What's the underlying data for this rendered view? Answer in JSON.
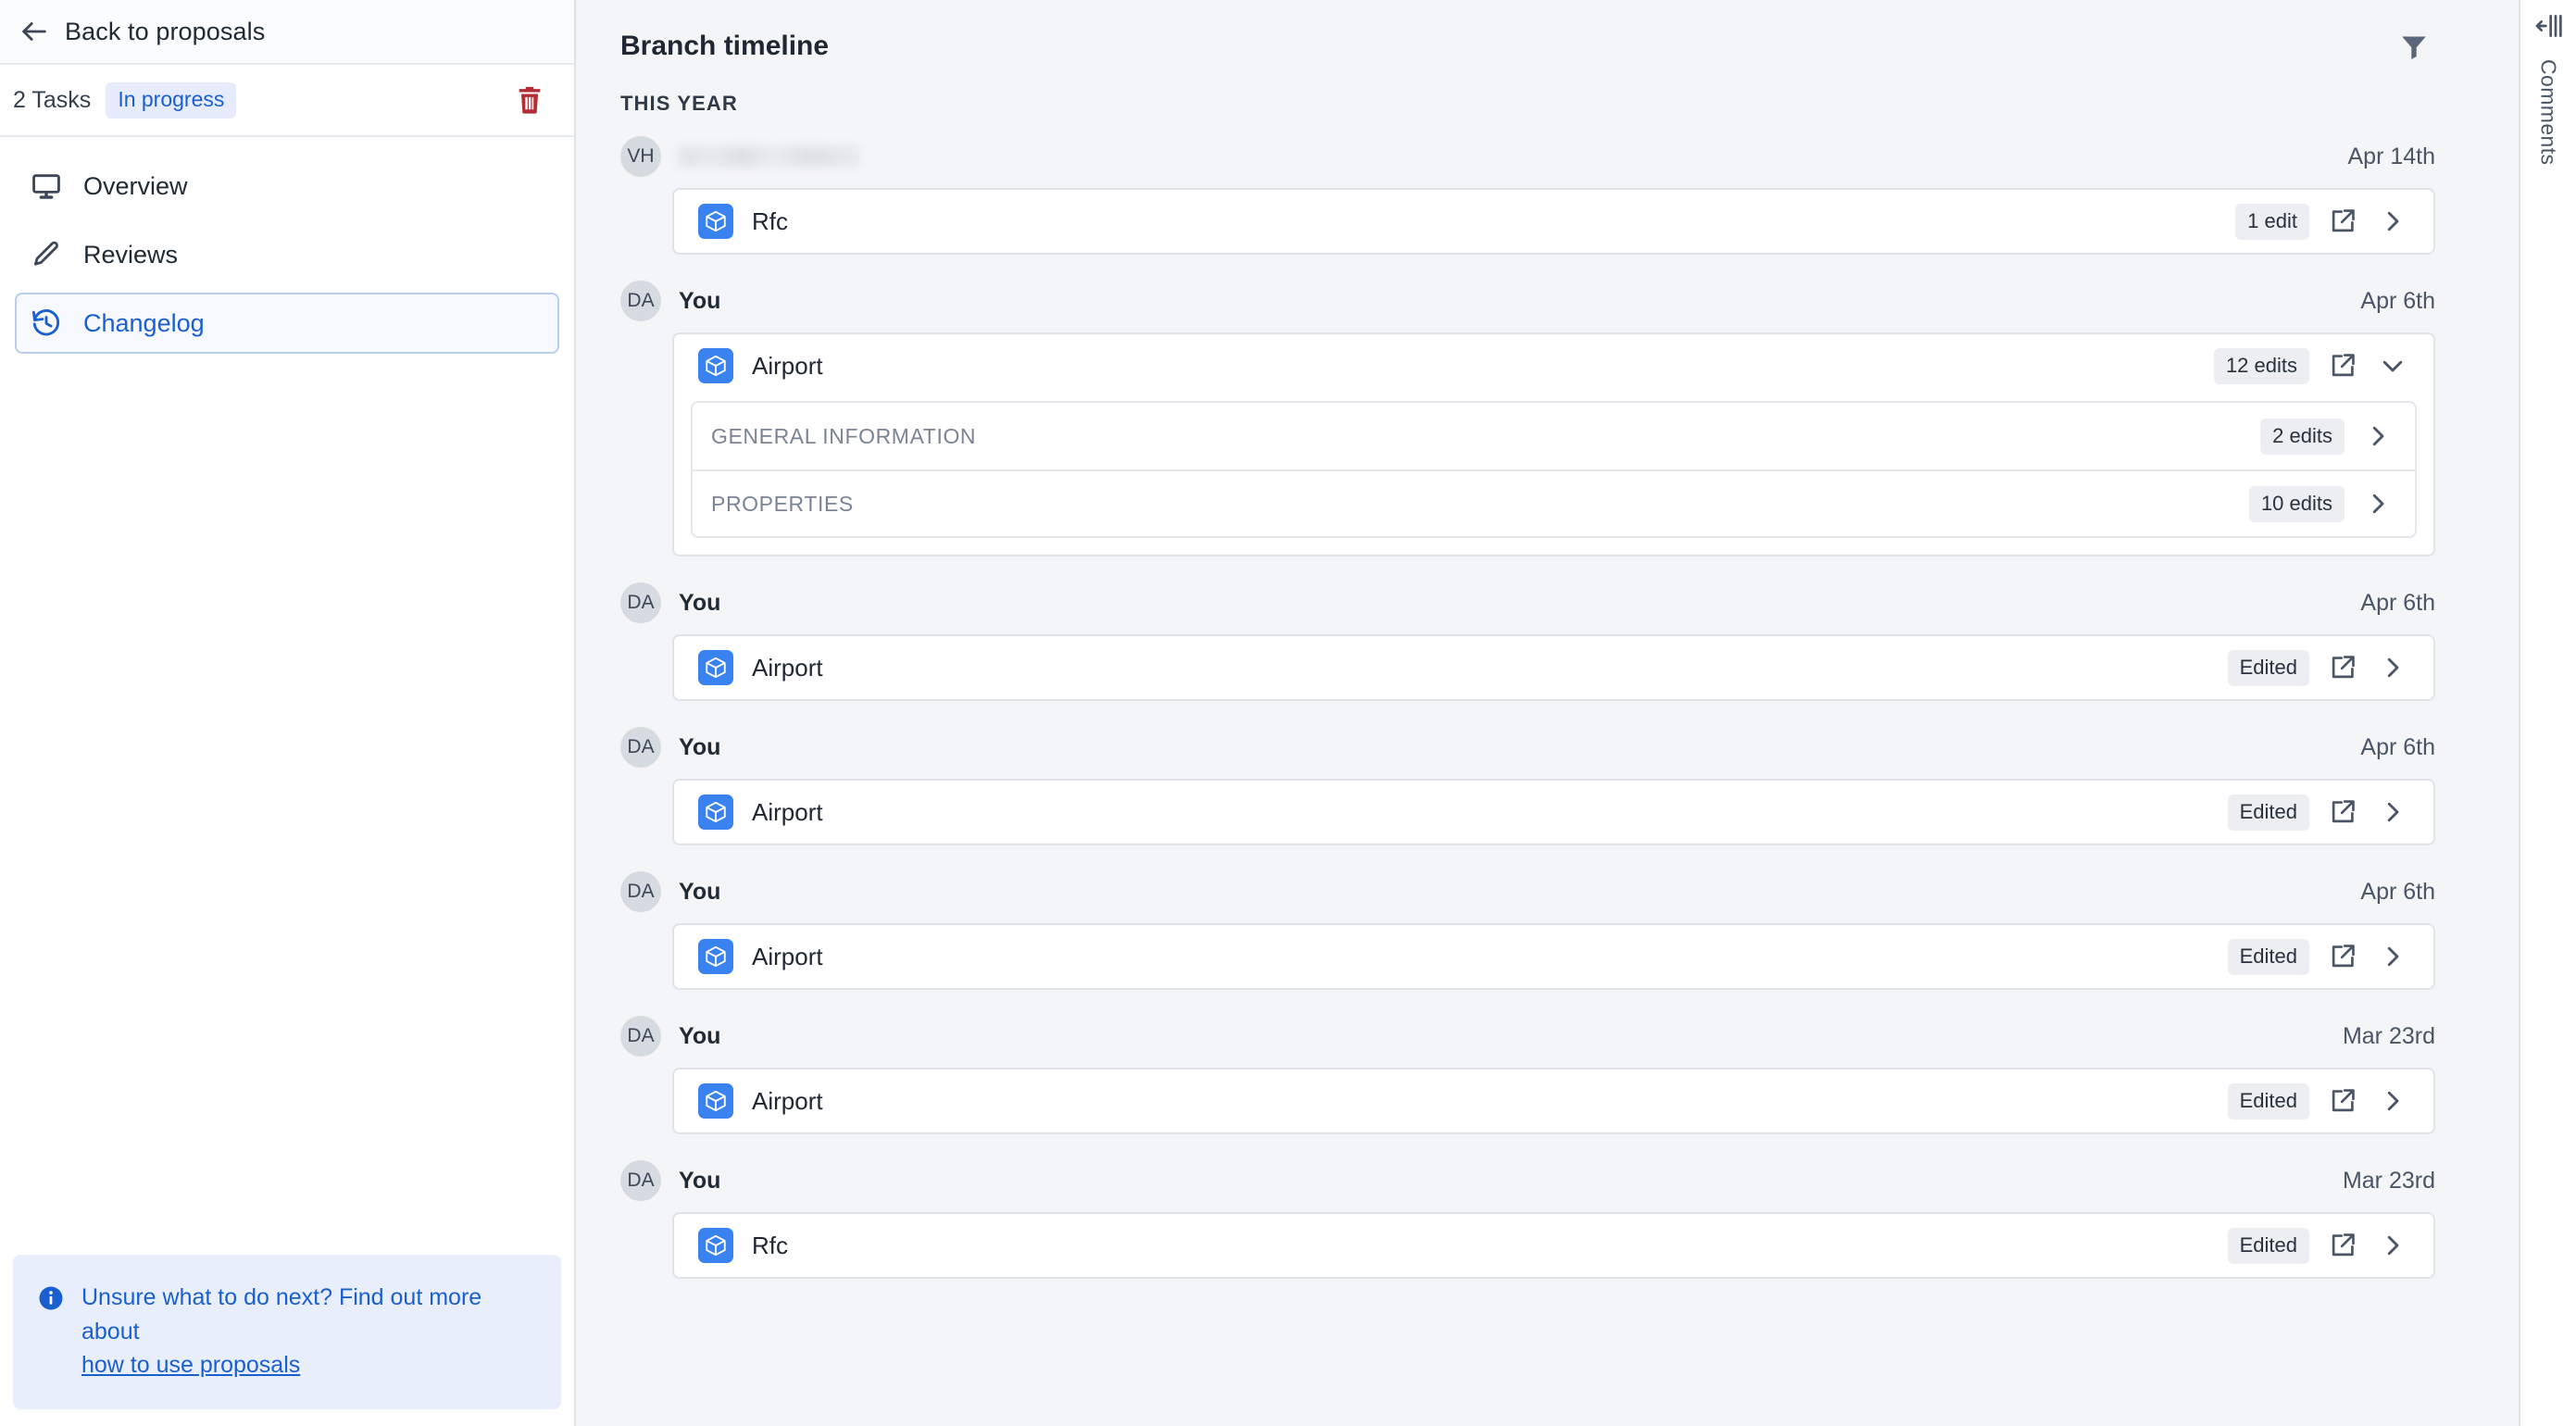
{
  "sidebar": {
    "back": {
      "label": "Back to proposals",
      "icon": "arrow-left-icon"
    },
    "tasks": {
      "count_label": "2 Tasks",
      "status_label": "In progress",
      "delete_icon": "trash-icon"
    },
    "nav": [
      {
        "label": "Overview",
        "icon": "monitor-icon",
        "active": false
      },
      {
        "label": "Reviews",
        "icon": "pencil-icon",
        "active": false
      },
      {
        "label": "Changelog",
        "icon": "history-icon",
        "active": true
      }
    ],
    "info": {
      "icon": "info-icon",
      "text": "Unsure what to do next? Find out more about",
      "link": "how to use proposals"
    }
  },
  "main": {
    "title": "Branch timeline",
    "filter_icon": "filter-icon",
    "section_label": "THIS YEAR",
    "groups": [
      {
        "avatar": "VH",
        "actor": "",
        "actor_redacted": true,
        "date": "Apr 14th",
        "expanded": false,
        "items": [
          {
            "icon": "cube-icon",
            "name": "Rfc",
            "badge": "1 edit",
            "open_icon": "external-link-icon",
            "chevron": "chevron-right-icon"
          }
        ]
      },
      {
        "avatar": "DA",
        "actor": "You",
        "actor_redacted": false,
        "date": "Apr 6th",
        "expanded": true,
        "items": [
          {
            "icon": "cube-icon",
            "name": "Airport",
            "badge": "12 edits",
            "open_icon": "external-link-icon",
            "chevron": "chevron-down-icon",
            "sub_items": [
              {
                "label": "GENERAL INFORMATION",
                "badge": "2 edits",
                "chevron": "chevron-right-icon"
              },
              {
                "label": "PROPERTIES",
                "badge": "10 edits",
                "chevron": "chevron-right-icon"
              }
            ]
          }
        ]
      },
      {
        "avatar": "DA",
        "actor": "You",
        "actor_redacted": false,
        "date": "Apr 6th",
        "expanded": false,
        "items": [
          {
            "icon": "cube-icon",
            "name": "Airport",
            "badge": "Edited",
            "open_icon": "external-link-icon",
            "chevron": "chevron-right-icon"
          }
        ]
      },
      {
        "avatar": "DA",
        "actor": "You",
        "actor_redacted": false,
        "date": "Apr 6th",
        "expanded": false,
        "items": [
          {
            "icon": "cube-icon",
            "name": "Airport",
            "badge": "Edited",
            "open_icon": "external-link-icon",
            "chevron": "chevron-right-icon"
          }
        ]
      },
      {
        "avatar": "DA",
        "actor": "You",
        "actor_redacted": false,
        "date": "Apr 6th",
        "expanded": false,
        "items": [
          {
            "icon": "cube-icon",
            "name": "Airport",
            "badge": "Edited",
            "open_icon": "external-link-icon",
            "chevron": "chevron-right-icon"
          }
        ]
      },
      {
        "avatar": "DA",
        "actor": "You",
        "actor_redacted": false,
        "date": "Mar 23rd",
        "expanded": false,
        "items": [
          {
            "icon": "cube-icon",
            "name": "Airport",
            "badge": "Edited",
            "open_icon": "external-link-icon",
            "chevron": "chevron-right-icon"
          }
        ]
      },
      {
        "avatar": "DA",
        "actor": "You",
        "actor_redacted": false,
        "date": "Mar 23rd",
        "expanded": false,
        "items": [
          {
            "icon": "cube-icon",
            "name": "Rfc",
            "badge": "Edited",
            "open_icon": "external-link-icon",
            "chevron": "chevron-right-icon"
          }
        ]
      }
    ]
  },
  "right_rail": {
    "toggle_icon": "collapse-panel-icon",
    "label": "Comments"
  },
  "colors": {
    "accent_blue": "#1a5fd0",
    "cube_blue": "#3a82f0",
    "page_bg": "#f4f5f7",
    "card_bg": "#ffffff",
    "border": "#dfe3e8",
    "muted_text": "#7a8494",
    "danger_red": "#b22d35",
    "badge_bg": "#eceef1",
    "status_badge_bg": "#e6ecfb",
    "info_bg": "#e8eefb"
  }
}
